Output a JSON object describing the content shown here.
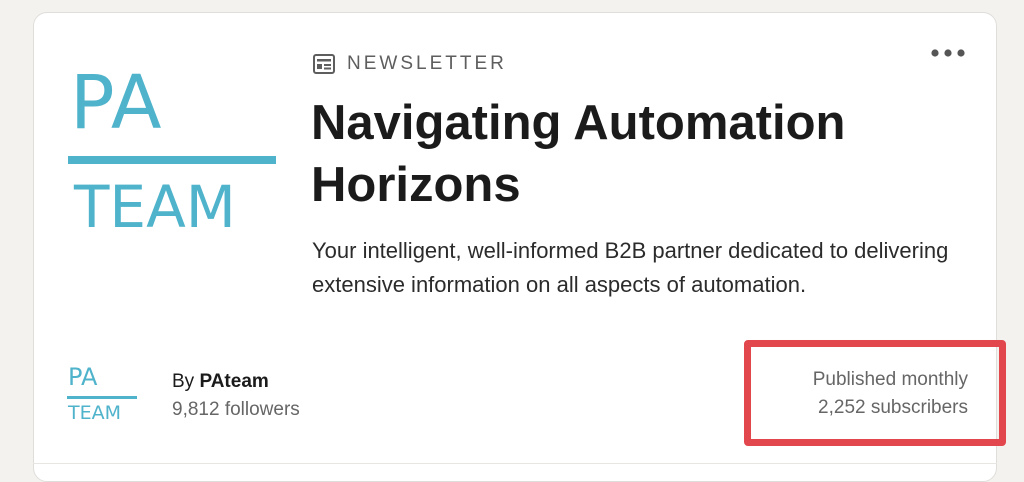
{
  "newsletter": {
    "label": "NEWSLETTER",
    "title": "Navigating Automation Horizons",
    "description": "Your intelligent, well-informed B2B partner dedicated to delivering extensive information on all aspects of automation.",
    "logo": {
      "top_text": "PA",
      "bottom_text": "TEAM"
    },
    "menu_icon": "more-horizontal-icon",
    "label_icon": "newsletter-icon"
  },
  "author": {
    "by_prefix": "By ",
    "name": "PAteam",
    "followers": "9,812 followers",
    "logo": {
      "top_text": "PA",
      "bottom_text": "TEAM"
    }
  },
  "meta": {
    "frequency": "Published monthly",
    "subscribers": "2,252 subscribers"
  },
  "colors": {
    "brand": "#4fb3cb",
    "highlight": "#e2474d",
    "title": "#1b1b1b",
    "secondary_text": "#666666"
  }
}
